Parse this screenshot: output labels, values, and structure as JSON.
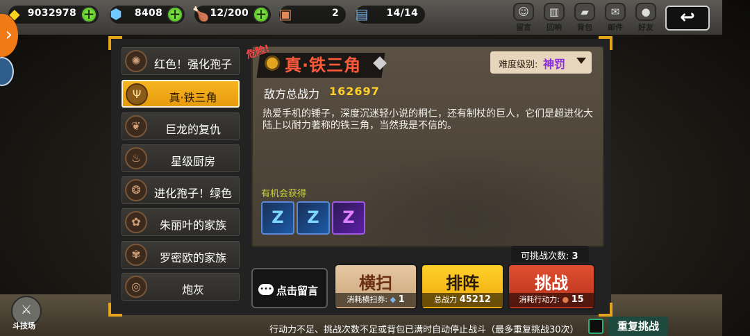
{
  "currencies": [
    {
      "icon": "gold-coin-icon",
      "value": "9032978",
      "has_plus": true
    },
    {
      "icon": "diamond-icon",
      "value": "8408",
      "has_plus": true
    },
    {
      "icon": "stamina-drumstick-icon",
      "value": "12/200",
      "has_plus": true
    },
    {
      "icon": "ticket-card-icon",
      "value": "2",
      "has_plus": false
    },
    {
      "icon": "blue-card-icon",
      "value": "14/14",
      "has_plus": false
    }
  ],
  "top_menu": [
    {
      "icon": "mentor-icon",
      "label": "留言"
    },
    {
      "icon": "history-icon",
      "label": "回响"
    },
    {
      "icon": "bag-icon",
      "label": "背包"
    },
    {
      "icon": "mail-icon",
      "label": "邮件"
    },
    {
      "icon": "friends-icon",
      "label": "好友"
    }
  ],
  "back_button": "↩",
  "stage_list": [
    {
      "label": "红色！强化孢子",
      "icon": "spore-icon",
      "active": false
    },
    {
      "label": "真·铁三角",
      "icon": "trident-icon",
      "active": true
    },
    {
      "label": "巨龙的复仇",
      "icon": "dragon-icon",
      "active": false
    },
    {
      "label": "星级厨房",
      "icon": "kitchen-icon",
      "active": false
    },
    {
      "label": "进化孢子！绿色",
      "icon": "evolve-spore-icon",
      "active": false
    },
    {
      "label": "朱丽叶的家族",
      "icon": "juliet-icon",
      "active": false
    },
    {
      "label": "罗密欧的家族",
      "icon": "romeo-icon",
      "active": false
    },
    {
      "label": "炮灰",
      "icon": "target-icon",
      "active": false
    }
  ],
  "detail": {
    "danger_tag": "危险!",
    "title": "真·铁三角",
    "difficulty_label": "难度级别:",
    "difficulty_value": "神罚",
    "enemy_power_label": "敌方总战力",
    "enemy_power_value": "162697",
    "description": "热爱手机的锤子，深度沉迷轻小说的桐仁，还有制杖的巨人，它们是超进化大陆上以耐力著称的铁三角，当然我是不信的。",
    "chance_label": "有机会获得",
    "rewards": [
      {
        "icon": "blue-rune-icon",
        "glyph": "Z",
        "tier": "blue"
      },
      {
        "icon": "blue-rune-icon",
        "glyph": "Z",
        "tier": "blue"
      },
      {
        "icon": "purple-rune-icon",
        "glyph": "Z",
        "tier": "purple"
      }
    ],
    "attempts_label": "可挑战次数:",
    "attempts_value": "3"
  },
  "buttons": {
    "message_label": "点击留言",
    "sweep_label": "横扫",
    "sweep_sub_label": "消耗横扫券:",
    "sweep_sub_value": "1",
    "lineup_label": "排阵",
    "lineup_sub_label": "总战力",
    "lineup_sub_value": "45212",
    "challenge_label": "挑战",
    "challenge_sub_label": "消耗行动力:",
    "challenge_sub_value": "15"
  },
  "bottom": {
    "stage_label": "斗技场",
    "notice": "行动力不足、挑战次数不足或背包已满时自动停止战斗（最多重复挑战30次）",
    "repeat_label": "重复挑战"
  },
  "colors": {
    "accent_gold": "#e6a41c",
    "title_red": "#ff5a3a",
    "power_yellow": "#ffcf2a",
    "difficulty_purple": "#8a2be2",
    "repeat_green": "#28b27a"
  }
}
